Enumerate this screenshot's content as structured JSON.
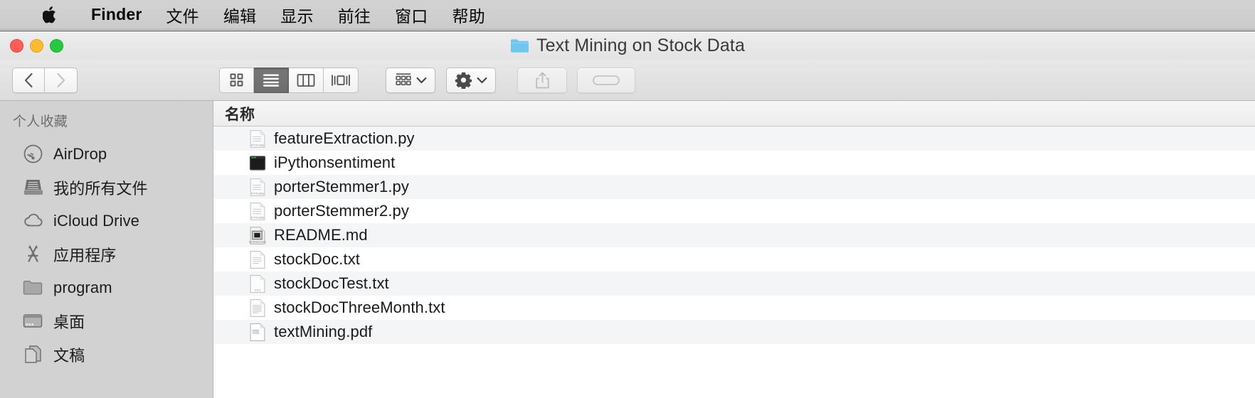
{
  "menubar": {
    "apple_icon": "apple-logo-icon",
    "items": [
      {
        "label": "Finder",
        "bold": true
      },
      {
        "label": "文件",
        "bold": false
      },
      {
        "label": "编辑",
        "bold": false
      },
      {
        "label": "显示",
        "bold": false
      },
      {
        "label": "前往",
        "bold": false
      },
      {
        "label": "窗口",
        "bold": false
      },
      {
        "label": "帮助",
        "bold": false
      }
    ]
  },
  "window": {
    "title": "Text Mining on Stock Data",
    "title_icon": "folder-icon",
    "traffic_lights": {
      "close": "#ff5f57",
      "minimize": "#febc2e",
      "zoom": "#28c840"
    }
  },
  "toolbar": {
    "back_label": "‹",
    "forward_label": "›",
    "view_modes": [
      {
        "name": "icon-view",
        "active": false
      },
      {
        "name": "list-view",
        "active": true
      },
      {
        "name": "column-view",
        "active": false
      },
      {
        "name": "coverflow-view",
        "active": false
      }
    ],
    "arrange_icon": "grid-arrange-icon",
    "action_icon": "gear-icon",
    "share_icon": "share-icon",
    "tag_icon": "tag-icon",
    "chevron_icon": "chevron-down-icon"
  },
  "sidebar": {
    "section_title": "个人收藏",
    "items": [
      {
        "label": "AirDrop",
        "icon": "airdrop-icon"
      },
      {
        "label": "我的所有文件",
        "icon": "all-my-files-icon"
      },
      {
        "label": "iCloud Drive",
        "icon": "icloud-icon"
      },
      {
        "label": "应用程序",
        "icon": "applications-icon"
      },
      {
        "label": "program",
        "icon": "folder-icon"
      },
      {
        "label": "桌面",
        "icon": "desktop-icon"
      },
      {
        "label": "文稿",
        "icon": "documents-icon"
      }
    ]
  },
  "filelist": {
    "column_header": "名称",
    "rows": [
      {
        "name": "featureExtraction.py",
        "icon": "python-file-icon"
      },
      {
        "name": "iPythonsentiment",
        "icon": "terminal-app-icon"
      },
      {
        "name": "porterStemmer1.py",
        "icon": "python-file-icon"
      },
      {
        "name": "porterStemmer2.py",
        "icon": "python-file-icon"
      },
      {
        "name": "README.md",
        "icon": "markdown-file-icon"
      },
      {
        "name": "stockDoc.txt",
        "icon": "text-file-icon"
      },
      {
        "name": "stockDocTest.txt",
        "icon": "text-file-icon"
      },
      {
        "name": "stockDocThreeMonth.txt",
        "icon": "text-file-icon"
      },
      {
        "name": "textMining.pdf",
        "icon": "pdf-file-icon"
      }
    ]
  }
}
